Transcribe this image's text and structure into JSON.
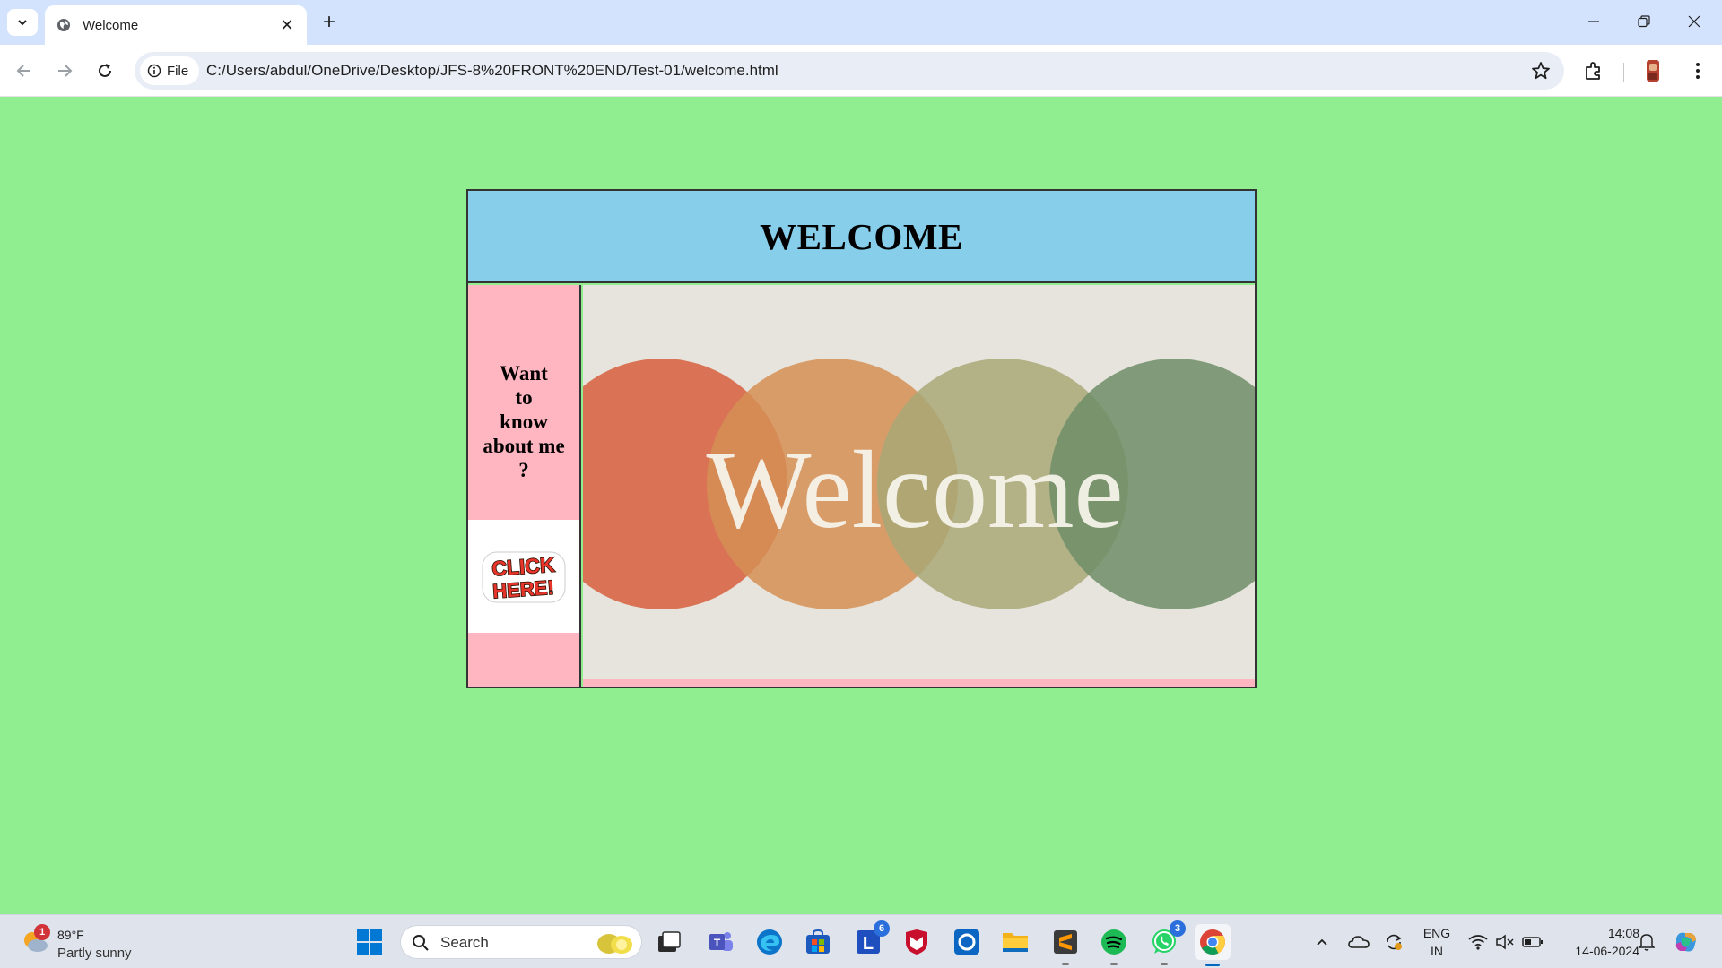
{
  "browser": {
    "tab_title": "Welcome",
    "url_chip_label": "File",
    "url": "C:/Users/abdul/OneDrive/Desktop/JFS-8%20FRONT%20END/Test-01/welcome.html"
  },
  "page": {
    "heading": "WELCOME",
    "side_line1": "Want",
    "side_line2": "to",
    "side_line3": "know",
    "side_line4": "about me",
    "side_line5": "?",
    "click_label_top": "CLICK",
    "click_label_bottom": "HERE!",
    "image_text": "Welcome",
    "colors": {
      "page_bg": "#90ee90",
      "header_bg": "#87ceeb",
      "side_bg": "#ffb6c1",
      "circle1": "#d9694a",
      "circle2": "#d58f55",
      "circle3": "#a9a877",
      "circle4": "#6e8e68"
    }
  },
  "taskbar": {
    "weather_temp": "89°F",
    "weather_desc": "Partly sunny",
    "weather_badge": "1",
    "search_label": "Search",
    "lens_badge": "6",
    "whatsapp_badge": "3",
    "lang_line1": "ENG",
    "lang_line2": "IN",
    "time": "14:08",
    "date": "14-06-2024"
  }
}
